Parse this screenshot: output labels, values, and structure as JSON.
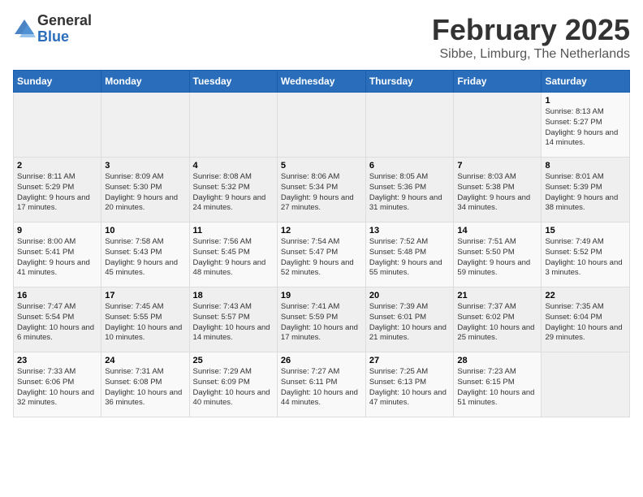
{
  "logo": {
    "general": "General",
    "blue": "Blue"
  },
  "header": {
    "month_year": "February 2025",
    "location": "Sibbe, Limburg, The Netherlands"
  },
  "days_of_week": [
    "Sunday",
    "Monday",
    "Tuesday",
    "Wednesday",
    "Thursday",
    "Friday",
    "Saturday"
  ],
  "weeks": [
    [
      {
        "num": "",
        "info": ""
      },
      {
        "num": "",
        "info": ""
      },
      {
        "num": "",
        "info": ""
      },
      {
        "num": "",
        "info": ""
      },
      {
        "num": "",
        "info": ""
      },
      {
        "num": "",
        "info": ""
      },
      {
        "num": "1",
        "info": "Sunrise: 8:13 AM\nSunset: 5:27 PM\nDaylight: 9 hours and 14 minutes."
      }
    ],
    [
      {
        "num": "2",
        "info": "Sunrise: 8:11 AM\nSunset: 5:29 PM\nDaylight: 9 hours and 17 minutes."
      },
      {
        "num": "3",
        "info": "Sunrise: 8:09 AM\nSunset: 5:30 PM\nDaylight: 9 hours and 20 minutes."
      },
      {
        "num": "4",
        "info": "Sunrise: 8:08 AM\nSunset: 5:32 PM\nDaylight: 9 hours and 24 minutes."
      },
      {
        "num": "5",
        "info": "Sunrise: 8:06 AM\nSunset: 5:34 PM\nDaylight: 9 hours and 27 minutes."
      },
      {
        "num": "6",
        "info": "Sunrise: 8:05 AM\nSunset: 5:36 PM\nDaylight: 9 hours and 31 minutes."
      },
      {
        "num": "7",
        "info": "Sunrise: 8:03 AM\nSunset: 5:38 PM\nDaylight: 9 hours and 34 minutes."
      },
      {
        "num": "8",
        "info": "Sunrise: 8:01 AM\nSunset: 5:39 PM\nDaylight: 9 hours and 38 minutes."
      }
    ],
    [
      {
        "num": "9",
        "info": "Sunrise: 8:00 AM\nSunset: 5:41 PM\nDaylight: 9 hours and 41 minutes."
      },
      {
        "num": "10",
        "info": "Sunrise: 7:58 AM\nSunset: 5:43 PM\nDaylight: 9 hours and 45 minutes."
      },
      {
        "num": "11",
        "info": "Sunrise: 7:56 AM\nSunset: 5:45 PM\nDaylight: 9 hours and 48 minutes."
      },
      {
        "num": "12",
        "info": "Sunrise: 7:54 AM\nSunset: 5:47 PM\nDaylight: 9 hours and 52 minutes."
      },
      {
        "num": "13",
        "info": "Sunrise: 7:52 AM\nSunset: 5:48 PM\nDaylight: 9 hours and 55 minutes."
      },
      {
        "num": "14",
        "info": "Sunrise: 7:51 AM\nSunset: 5:50 PM\nDaylight: 9 hours and 59 minutes."
      },
      {
        "num": "15",
        "info": "Sunrise: 7:49 AM\nSunset: 5:52 PM\nDaylight: 10 hours and 3 minutes."
      }
    ],
    [
      {
        "num": "16",
        "info": "Sunrise: 7:47 AM\nSunset: 5:54 PM\nDaylight: 10 hours and 6 minutes."
      },
      {
        "num": "17",
        "info": "Sunrise: 7:45 AM\nSunset: 5:55 PM\nDaylight: 10 hours and 10 minutes."
      },
      {
        "num": "18",
        "info": "Sunrise: 7:43 AM\nSunset: 5:57 PM\nDaylight: 10 hours and 14 minutes."
      },
      {
        "num": "19",
        "info": "Sunrise: 7:41 AM\nSunset: 5:59 PM\nDaylight: 10 hours and 17 minutes."
      },
      {
        "num": "20",
        "info": "Sunrise: 7:39 AM\nSunset: 6:01 PM\nDaylight: 10 hours and 21 minutes."
      },
      {
        "num": "21",
        "info": "Sunrise: 7:37 AM\nSunset: 6:02 PM\nDaylight: 10 hours and 25 minutes."
      },
      {
        "num": "22",
        "info": "Sunrise: 7:35 AM\nSunset: 6:04 PM\nDaylight: 10 hours and 29 minutes."
      }
    ],
    [
      {
        "num": "23",
        "info": "Sunrise: 7:33 AM\nSunset: 6:06 PM\nDaylight: 10 hours and 32 minutes."
      },
      {
        "num": "24",
        "info": "Sunrise: 7:31 AM\nSunset: 6:08 PM\nDaylight: 10 hours and 36 minutes."
      },
      {
        "num": "25",
        "info": "Sunrise: 7:29 AM\nSunset: 6:09 PM\nDaylight: 10 hours and 40 minutes."
      },
      {
        "num": "26",
        "info": "Sunrise: 7:27 AM\nSunset: 6:11 PM\nDaylight: 10 hours and 44 minutes."
      },
      {
        "num": "27",
        "info": "Sunrise: 7:25 AM\nSunset: 6:13 PM\nDaylight: 10 hours and 47 minutes."
      },
      {
        "num": "28",
        "info": "Sunrise: 7:23 AM\nSunset: 6:15 PM\nDaylight: 10 hours and 51 minutes."
      },
      {
        "num": "",
        "info": ""
      }
    ]
  ]
}
